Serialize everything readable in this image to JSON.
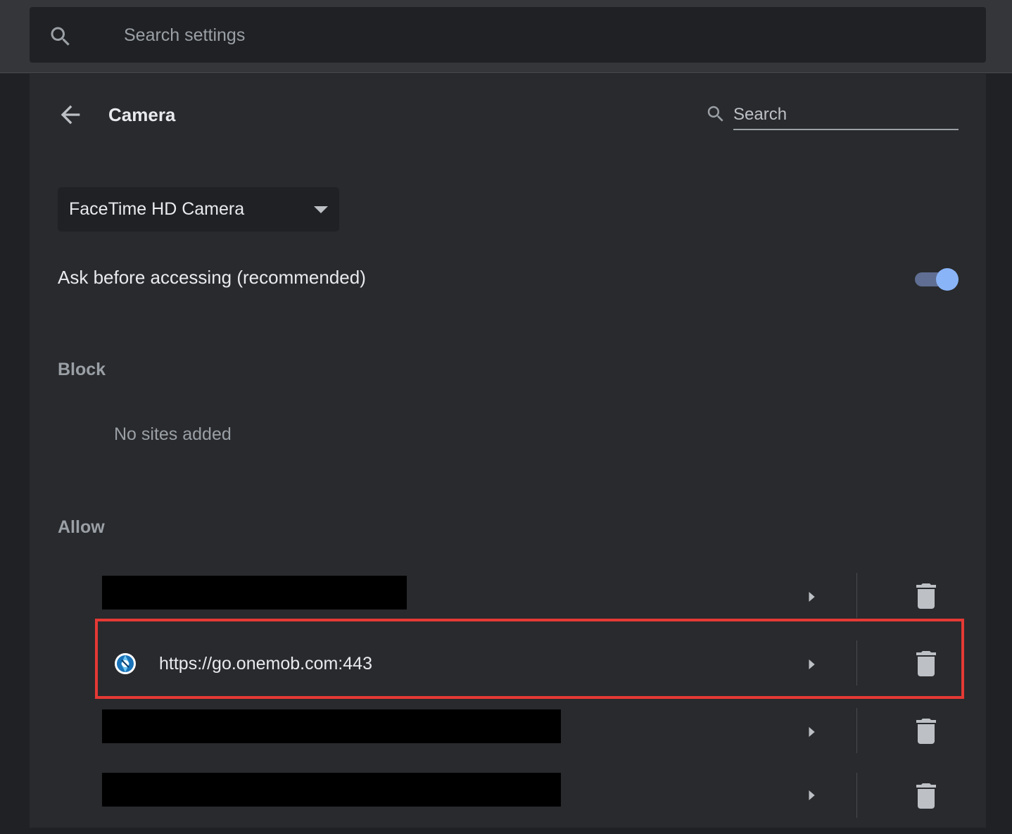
{
  "toolbar": {
    "search_placeholder": "Search settings",
    "search_icon": "search-icon"
  },
  "header": {
    "title": "Camera",
    "back_icon": "arrow-back-icon",
    "search_placeholder": "Search"
  },
  "device": {
    "selected": "FaceTime HD Camera"
  },
  "ask_setting": {
    "label": "Ask before accessing (recommended)",
    "enabled": true
  },
  "block": {
    "header": "Block",
    "empty_text": "No sites added"
  },
  "allow": {
    "header": "Allow",
    "sites": [
      {
        "url": "",
        "redacted": true
      },
      {
        "url": "https://go.onemob.com:443",
        "redacted": false,
        "highlighted": true
      },
      {
        "url": "",
        "redacted": true
      },
      {
        "url": "",
        "redacted": true
      }
    ]
  },
  "colors": {
    "accent": "#8ab4f8",
    "highlight_border": "#e53935",
    "background": "#202124",
    "card": "#292a2d"
  }
}
